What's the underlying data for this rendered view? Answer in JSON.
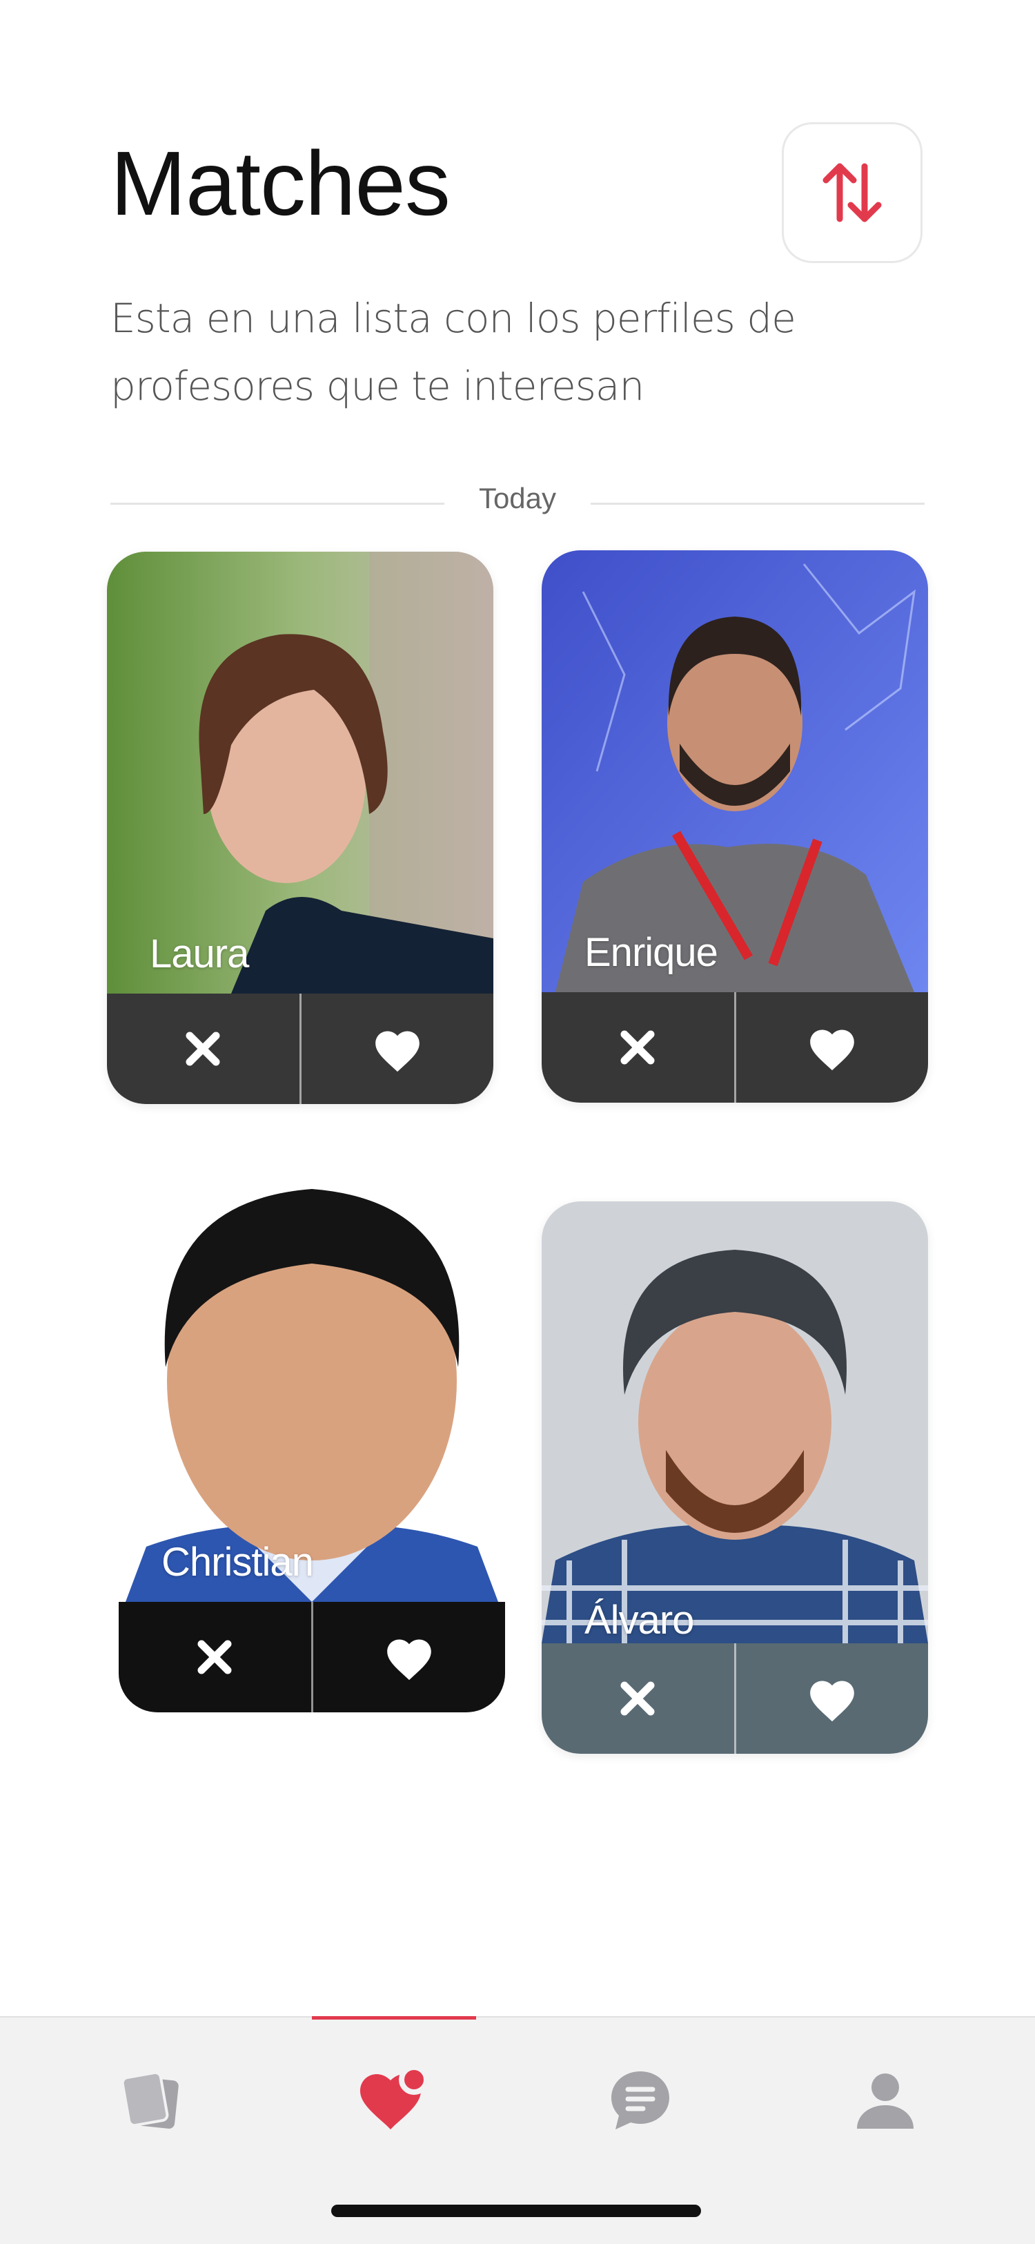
{
  "header": {
    "title": "Matches",
    "subtitle": "Esta en una lista con los perfiles de profesores que te interesan",
    "sort_icon": "sort-arrows-icon",
    "accent_color": "#e23a4d"
  },
  "section": {
    "date_label": "Today"
  },
  "matches": [
    {
      "name": "Laura"
    },
    {
      "name": "Enrique"
    },
    {
      "name": "Christian"
    },
    {
      "name": "Álvaro"
    }
  ],
  "card_actions": {
    "reject_icon": "close-icon",
    "like_icon": "heart-icon"
  },
  "tabbar": {
    "tabs": [
      {
        "icon": "cards-icon",
        "active": false
      },
      {
        "icon": "heart-notification-icon",
        "active": true
      },
      {
        "icon": "chat-icon",
        "active": false
      },
      {
        "icon": "profile-icon",
        "active": false
      }
    ],
    "active_color": "#e23a4d",
    "inactive_color": "#a3a3a8"
  }
}
